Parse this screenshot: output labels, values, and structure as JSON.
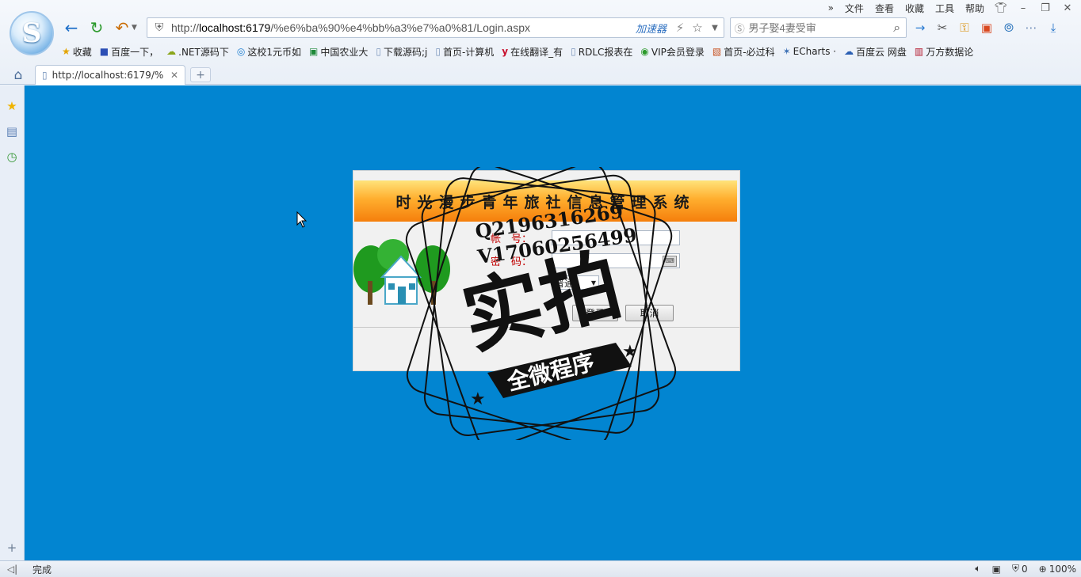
{
  "menu": {
    "items": [
      "文件",
      "查看",
      "收藏",
      "工具",
      "帮助"
    ]
  },
  "address": {
    "url_prefix": "http://",
    "url_host": "localhost:6179",
    "url_path": "/%e6%ba%90%e4%bb%a3%e7%a0%81/Login.aspx",
    "accelerator_label": "加速器"
  },
  "search": {
    "placeholder": "男子娶4妻受审"
  },
  "bookmarks": [
    {
      "icon": "star-icon",
      "label": "收藏"
    },
    {
      "icon": "paw-icon",
      "label": "百度一下，"
    },
    {
      "icon": "cloud-icon",
      "label": ".NET源码下"
    },
    {
      "icon": "globe-icon",
      "label": "这校1元币如"
    },
    {
      "icon": "book-icon",
      "label": "中国农业大"
    },
    {
      "icon": "page-icon",
      "label": "下载源码;j"
    },
    {
      "icon": "page-icon",
      "label": "首页-计算机"
    },
    {
      "icon": "y-icon",
      "label": "在线翻译_有"
    },
    {
      "icon": "page-icon",
      "label": "RDLC报表在"
    },
    {
      "icon": "vip-icon",
      "label": "VIP会员登录"
    },
    {
      "icon": "must-icon",
      "label": "首页-必过科"
    },
    {
      "icon": "echarts-icon",
      "label": "ECharts ·"
    },
    {
      "icon": "baidu-cloud-icon",
      "label": "百度云 网盘"
    },
    {
      "icon": "wanfang-icon",
      "label": "万方数据论"
    }
  ],
  "tab": {
    "title": "http://localhost:6179/%"
  },
  "login": {
    "system_title": "时光漫步青年旅社信息管理系统",
    "account_label": "帐　号：",
    "password_label": "密　码：",
    "role_value": "普通",
    "login_button": "登录",
    "cancel_button": "取消"
  },
  "watermark": {
    "qq_line": "Q2196316269",
    "v_line": "V17060256499",
    "main_text": "实拍",
    "banner_text": "全微程序"
  },
  "status": {
    "text": "完成",
    "blocked_count": "0",
    "zoom": "100%"
  },
  "colors": {
    "content_bg": "#0285d1",
    "title_gradient_top": "#ffe37a",
    "title_gradient_bottom": "#f57f0c",
    "label_red": "#c00000"
  }
}
